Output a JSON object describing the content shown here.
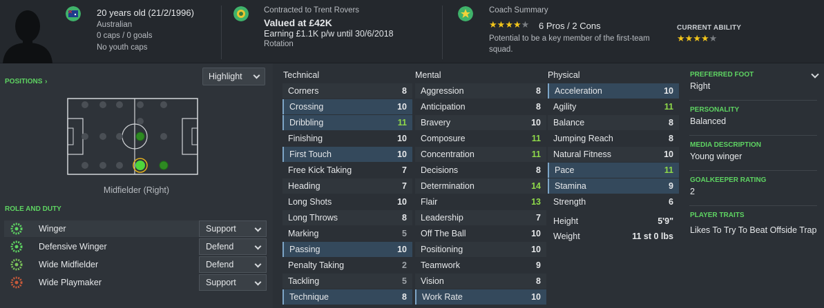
{
  "header": {
    "age": "20 years old (21/2/1996)",
    "nationality": "Australian",
    "caps_goals": "0 caps / 0 goals",
    "youth_caps": "No youth caps",
    "contract_label": "Contracted to Trent Rovers",
    "value": "Valued at £42K",
    "earning": "Earning £1.1K p/w until 30/6/2018",
    "squad_status": "Rotation",
    "coach_summary_label": "Coach Summary",
    "coach_stars": 4,
    "coach_stars_max": 5,
    "pros_cons": "6 Pros / 2 Cons",
    "potential_line1": "Potential to be a key member of the first-team",
    "potential_line2": "squad.",
    "current_ability_label": "CURRENT ABILITY",
    "current_ability_stars": 4,
    "current_ability_max": 5
  },
  "positions": {
    "label": "POSITIONS",
    "dropdown": "Highlight",
    "position_text": "Midfielder (Right)"
  },
  "roles": {
    "label": "ROLE AND DUTY",
    "items": [
      {
        "name": "Winger",
        "duty": "Support",
        "ring": "#5ed462"
      },
      {
        "name": "Defensive Winger",
        "duty": "Defend",
        "ring": "#5ed462"
      },
      {
        "name": "Wide Midfielder",
        "duty": "Defend",
        "ring": "#7bc25a"
      },
      {
        "name": "Wide Playmaker",
        "duty": "Support",
        "ring": "#c85a3a"
      }
    ]
  },
  "technical": {
    "title": "Technical",
    "items": [
      {
        "name": "Corners",
        "value": "8"
      },
      {
        "name": "Crossing",
        "value": "10"
      },
      {
        "name": "Dribbling",
        "value": "11"
      },
      {
        "name": "Finishing",
        "value": "10"
      },
      {
        "name": "First Touch",
        "value": "10"
      },
      {
        "name": "Free Kick Taking",
        "value": "7"
      },
      {
        "name": "Heading",
        "value": "7"
      },
      {
        "name": "Long Shots",
        "value": "10"
      },
      {
        "name": "Long Throws",
        "value": "8"
      },
      {
        "name": "Marking",
        "value": "5"
      },
      {
        "name": "Passing",
        "value": "10"
      },
      {
        "name": "Penalty Taking",
        "value": "2"
      },
      {
        "name": "Tackling",
        "value": "5"
      },
      {
        "name": "Technique",
        "value": "8"
      }
    ]
  },
  "mental": {
    "title": "Mental",
    "items": [
      {
        "name": "Aggression",
        "value": "8"
      },
      {
        "name": "Anticipation",
        "value": "8"
      },
      {
        "name": "Bravery",
        "value": "10"
      },
      {
        "name": "Composure",
        "value": "11"
      },
      {
        "name": "Concentration",
        "value": "11"
      },
      {
        "name": "Decisions",
        "value": "8"
      },
      {
        "name": "Determination",
        "value": "14"
      },
      {
        "name": "Flair",
        "value": "13"
      },
      {
        "name": "Leadership",
        "value": "7"
      },
      {
        "name": "Off The Ball",
        "value": "10"
      },
      {
        "name": "Positioning",
        "value": "10"
      },
      {
        "name": "Teamwork",
        "value": "9"
      },
      {
        "name": "Vision",
        "value": "8"
      },
      {
        "name": "Work Rate",
        "value": "10"
      }
    ]
  },
  "physical": {
    "title": "Physical",
    "items": [
      {
        "name": "Acceleration",
        "value": "10"
      },
      {
        "name": "Agility",
        "value": "11"
      },
      {
        "name": "Balance",
        "value": "8"
      },
      {
        "name": "Jumping Reach",
        "value": "8"
      },
      {
        "name": "Natural Fitness",
        "value": "10"
      },
      {
        "name": "Pace",
        "value": "11"
      },
      {
        "name": "Stamina",
        "value": "9"
      },
      {
        "name": "Strength",
        "value": "6"
      }
    ],
    "height_label": "Height",
    "height": "5'9\"",
    "weight_label": "Weight",
    "weight": "11 st 0 lbs"
  },
  "sidebar": {
    "preferred_foot_label": "PREFERRED FOOT",
    "preferred_foot": "Right",
    "personality_label": "PERSONALITY",
    "personality": "Balanced",
    "media_label": "MEDIA DESCRIPTION",
    "media": "Young winger",
    "gk_label": "GOALKEEPER RATING",
    "gk": "2",
    "traits_label": "PLAYER TRAITS",
    "traits": "Likes To Try To Beat Offside Trap"
  },
  "colors": {
    "accent_green": "#5ed462",
    "highlight_row": "#34495c",
    "value_green": "#8fd94a",
    "value_grey": "#9ea3a8"
  }
}
